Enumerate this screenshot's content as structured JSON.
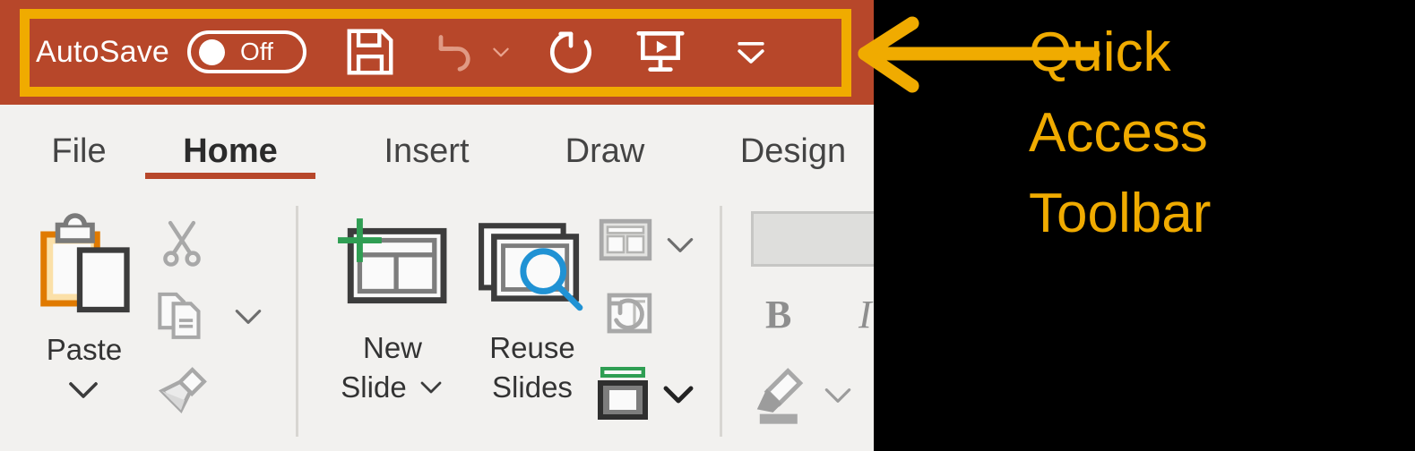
{
  "app": {
    "titlebar": {
      "autosave_label": "AutoSave",
      "autosave_state": "Off",
      "bg_color": "#b7472a",
      "buttons": [
        {
          "name": "save-button",
          "icon": "floppy-disk-icon",
          "enabled": true
        },
        {
          "name": "undo-button",
          "icon": "undo-arrow-icon",
          "enabled": false,
          "has_dropdown": true
        },
        {
          "name": "redo-button",
          "icon": "redo-arrow-icon",
          "enabled": true
        },
        {
          "name": "start-presentation-button",
          "icon": "presentation-screen-icon",
          "enabled": true
        },
        {
          "name": "customize-quick-access-toolbar-button",
          "icon": "bar-chevron-down-icon",
          "enabled": true
        }
      ]
    },
    "tabs": [
      {
        "label": "File",
        "active": false
      },
      {
        "label": "Home",
        "active": true
      },
      {
        "label": "Insert",
        "active": false
      },
      {
        "label": "Draw",
        "active": false
      },
      {
        "label": "Design",
        "active": false
      }
    ],
    "accent_color": "#b7472a",
    "ribbon": {
      "groups": [
        {
          "name": "clipboard",
          "commands": [
            {
              "name": "paste",
              "label": "Paste",
              "icon": "clipboard-paste-icon",
              "has_dropdown": true,
              "enabled": false
            },
            {
              "name": "cut",
              "label": "",
              "icon": "scissors-icon",
              "enabled": false
            },
            {
              "name": "copy",
              "label": "",
              "icon": "copy-documents-icon",
              "has_dropdown": true,
              "enabled": false
            },
            {
              "name": "format-painter",
              "label": "",
              "icon": "format-painter-brush-icon",
              "enabled": false
            }
          ]
        },
        {
          "name": "slides",
          "commands": [
            {
              "name": "new-slide",
              "label": "New\nSlide",
              "icon": "new-slide-icon",
              "has_dropdown": true,
              "enabled": true
            },
            {
              "name": "reuse-slides",
              "label": "Reuse\nSlides",
              "icon": "reuse-slides-icon",
              "enabled": true
            },
            {
              "name": "layout",
              "label": "",
              "icon": "slide-layout-icon",
              "has_dropdown": true,
              "enabled": false
            },
            {
              "name": "reset",
              "label": "",
              "icon": "reset-slide-icon",
              "enabled": false
            },
            {
              "name": "section",
              "label": "",
              "icon": "section-icon",
              "has_dropdown": true,
              "enabled": true
            }
          ]
        },
        {
          "name": "font",
          "commands": [
            {
              "name": "font-name-box",
              "label": "",
              "icon": "font-name-combobox",
              "enabled": true
            },
            {
              "name": "bold",
              "label": "B",
              "icon": "bold-icon",
              "enabled": false
            },
            {
              "name": "italic",
              "label": "I",
              "icon": "italic-icon",
              "enabled": false
            },
            {
              "name": "text-highlight-color",
              "label": "",
              "icon": "highlighter-pen-icon",
              "has_dropdown": true,
              "enabled": false
            }
          ]
        }
      ]
    }
  },
  "annotation": {
    "lines": [
      "Quick",
      "Access",
      "Toolbar"
    ],
    "color": "#f0ab00",
    "arrow": "left-arrow",
    "background": "#000000"
  }
}
